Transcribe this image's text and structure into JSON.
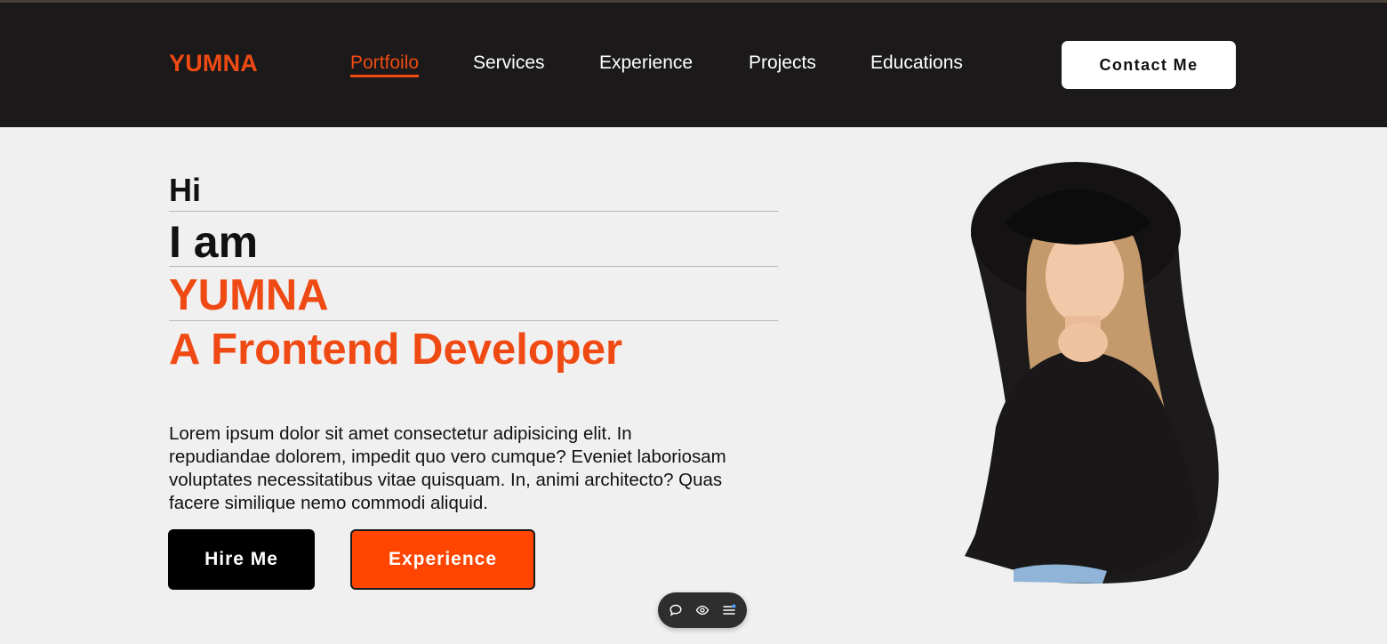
{
  "header": {
    "brand": "YUMNA",
    "nav": [
      {
        "label": "Portfoilo",
        "active": true
      },
      {
        "label": "Services",
        "active": false
      },
      {
        "label": "Experience",
        "active": false
      },
      {
        "label": "Projects",
        "active": false
      },
      {
        "label": "Educations",
        "active": false
      }
    ],
    "contact_label": "Contact Me"
  },
  "hero": {
    "greeting": "Hi",
    "intro": "I am",
    "name": "YUMNA",
    "role": "A Frontend Developer",
    "bio": "Lorem ipsum dolor sit amet consectetur adipisicing elit. In repudiandae dolorem, impedit quo vero cumque? Eveniet laboriosam voluptates necessitatibus vitae quisquam. In, animi architecto? Quas facere similique nemo commodi aliquid.",
    "hire_label": "Hire Me",
    "experience_label": "Experience"
  },
  "toolbar": {
    "icons": [
      "comment-icon",
      "eye-icon",
      "menu-icon"
    ]
  },
  "colors": {
    "accent": "#f04a14",
    "nav_bg": "#1b1919",
    "page_bg": "#f0f0f0",
    "button_orange": "#ff4500"
  }
}
